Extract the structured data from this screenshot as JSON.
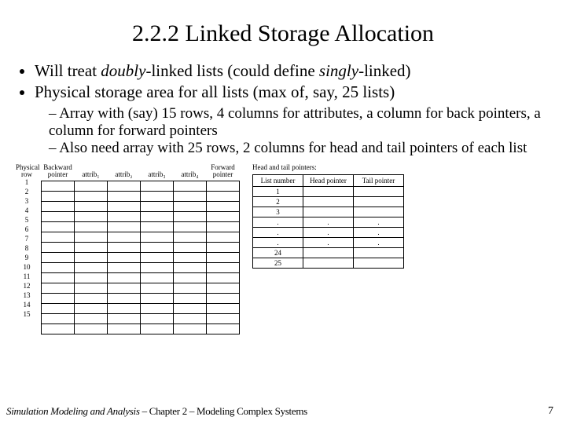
{
  "title": "2.2.2  Linked Storage Allocation",
  "bullets": {
    "b1_pre": "Will treat ",
    "b1_em1": "doubly",
    "b1_mid": "-linked lists (could define ",
    "b1_em2": "singly",
    "b1_post": "-linked)",
    "b2": "Physical storage area for all lists (max of, say, 25 lists)"
  },
  "sub": {
    "s1": "Array with (say) 15 rows, 4 columns for attributes, a column for back pointers, a column for forward pointers",
    "s2": "Also need array with 25 rows, 2 columns for head and tail pointers of each list"
  },
  "left": {
    "row_hdr_l1": "Physical",
    "row_hdr_l2": "row",
    "h_back_l1": "Backward",
    "h_back_l2": "pointer",
    "h_a1": "attrib₁",
    "h_a2": "attrib₂",
    "h_a3": "attrib₃",
    "h_a4": "attrib₄",
    "h_fwd_l1": "Forward",
    "h_fwd_l2": "pointer",
    "rows": [
      "1",
      "2",
      "3",
      "4",
      "5",
      "6",
      "7",
      "8",
      "9",
      "10",
      "11",
      "12",
      "13",
      "14",
      "15"
    ]
  },
  "right": {
    "title": "Head and tail pointers:",
    "h1": "List number",
    "h2": "Head pointer",
    "h3": "Tail pointer",
    "rows": [
      "1",
      "2",
      "3",
      ".",
      ".",
      ".",
      "24",
      "25"
    ],
    "dot": "."
  },
  "footer": {
    "book": "Simulation Modeling and Analysis",
    "chapter": " – Chapter 2 – Modeling Complex Systems"
  },
  "page": "7"
}
